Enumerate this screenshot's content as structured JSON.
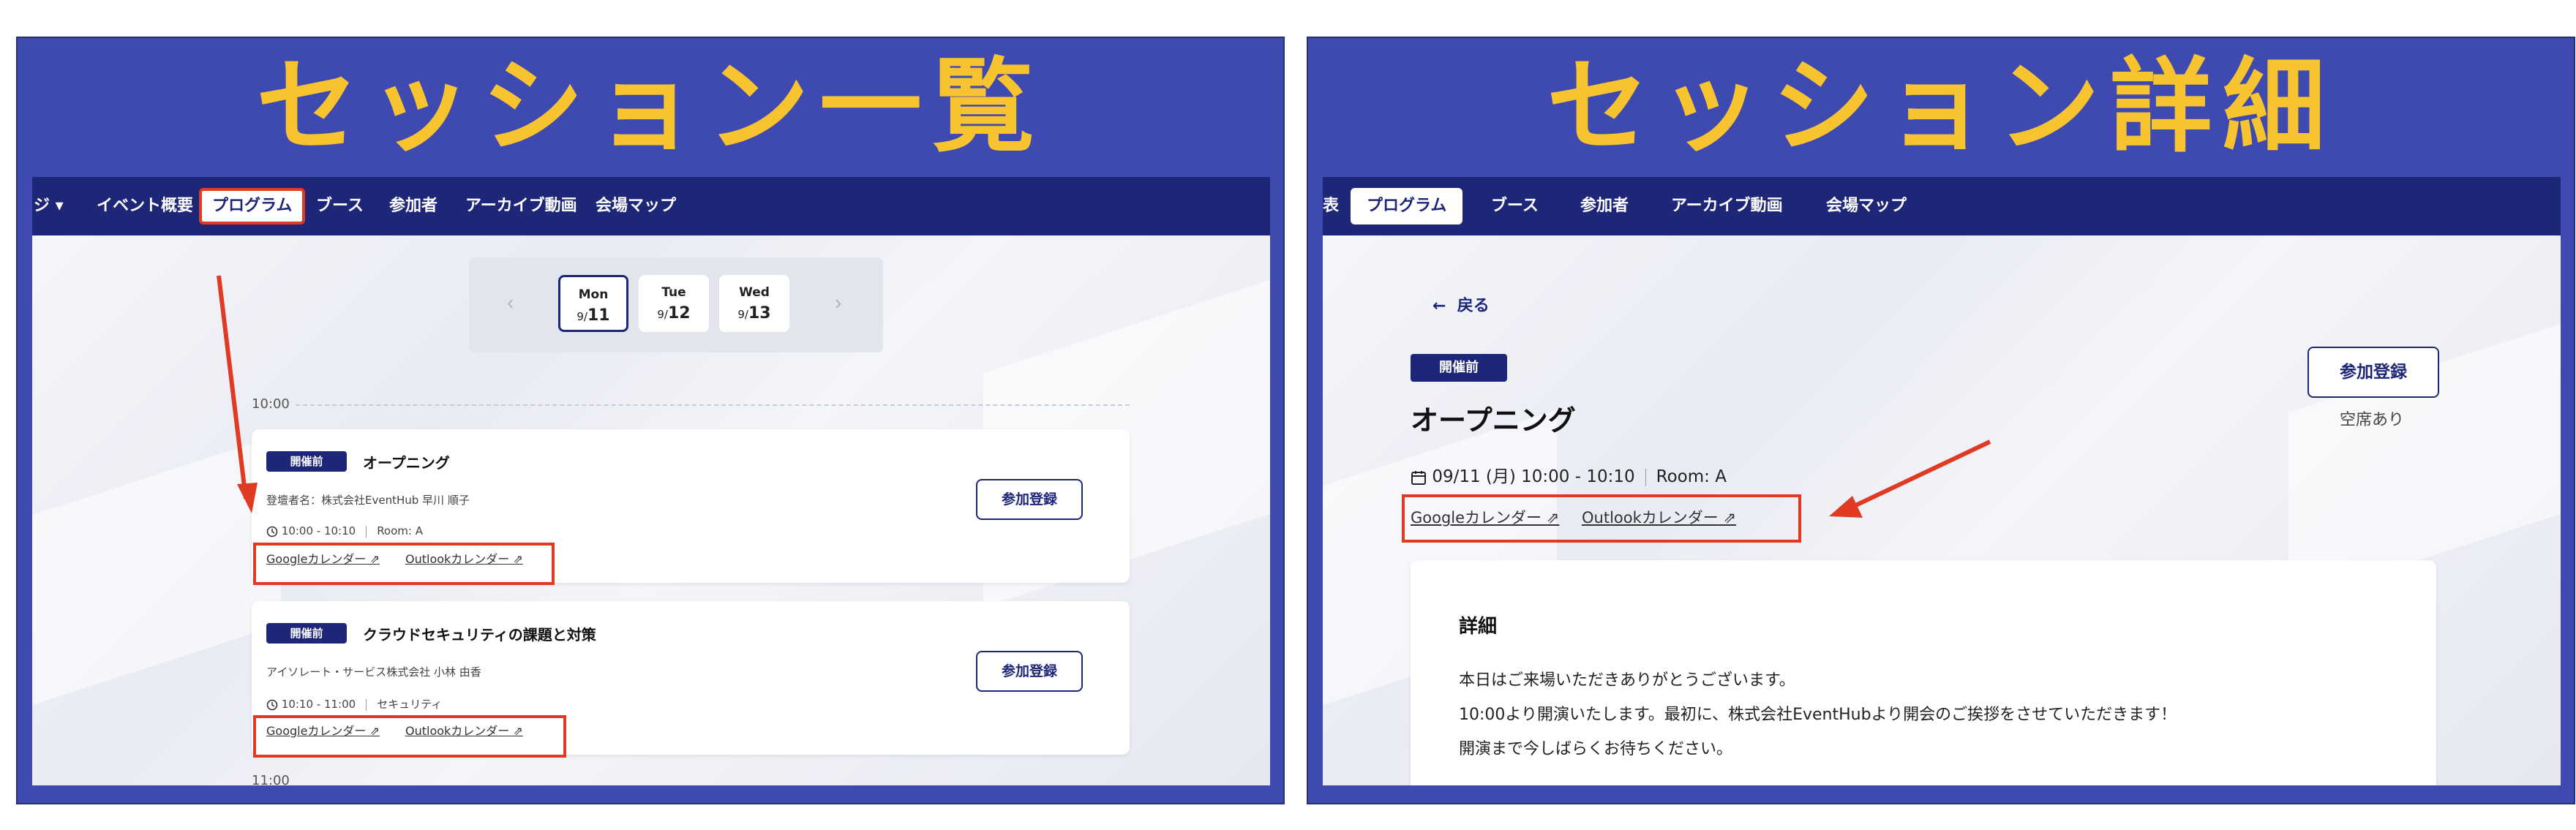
{
  "left": {
    "heading": "セッション一覧",
    "nav": {
      "dropdown": "ジ ▾",
      "items": [
        "イベント概要",
        "プログラム",
        "ブース",
        "参加者",
        "アーカイブ動画",
        "会場マップ"
      ]
    },
    "days": [
      {
        "weekday": "Mon",
        "month": "9/",
        "day": "11"
      },
      {
        "weekday": "Tue",
        "month": "9/",
        "day": "12"
      },
      {
        "weekday": "Wed",
        "month": "9/",
        "day": "13"
      }
    ],
    "times": [
      "10:00",
      "11:00"
    ],
    "sessions": [
      {
        "badge": "開催前",
        "title": "オープニング",
        "speaker": "登壇者名：株式会社EventHub 早川 順子",
        "time": "10:00 - 10:10",
        "room": "Room: A",
        "register": "参加登録",
        "gcal": "Googleカレンダー",
        "ocal": "Outlookカレンダー"
      },
      {
        "badge": "開催前",
        "title": "クラウドセキュリティの課題と対策",
        "speaker": "アイソレート・サービス株式会社 小林 由香",
        "time": "10:10 - 11:00",
        "room": "セキュリティ",
        "register": "参加登録",
        "gcal": "Googleカレンダー",
        "ocal": "Outlookカレンダー"
      }
    ]
  },
  "right": {
    "heading": "セッション詳細",
    "nav": {
      "cut": "表",
      "items": [
        "プログラム",
        "ブース",
        "参加者",
        "アーカイブ動画",
        "会場マップ"
      ]
    },
    "back": "戻る",
    "badge": "開催前",
    "title": "オープニング",
    "datetime": "09/11 (月) 10:00 - 10:10",
    "room": "Room: A",
    "gcal": "Googleカレンダー",
    "ocal": "Outlookカレンダー",
    "register": "参加登録",
    "seats": "空席あり",
    "detail": {
      "heading": "詳細",
      "lines": [
        "本日はご来場いただきありがとうございます。",
        "10:00より開演いたします。最初に、株式会社EventHubより開会のご挨拶をさせていただきます！",
        "開演まで今しばらくお待ちください。"
      ]
    }
  },
  "colors": {
    "panel": "#3f4ab0",
    "heading": "#f7c430",
    "nav": "#1e2678",
    "highlight": "#e03a22"
  }
}
